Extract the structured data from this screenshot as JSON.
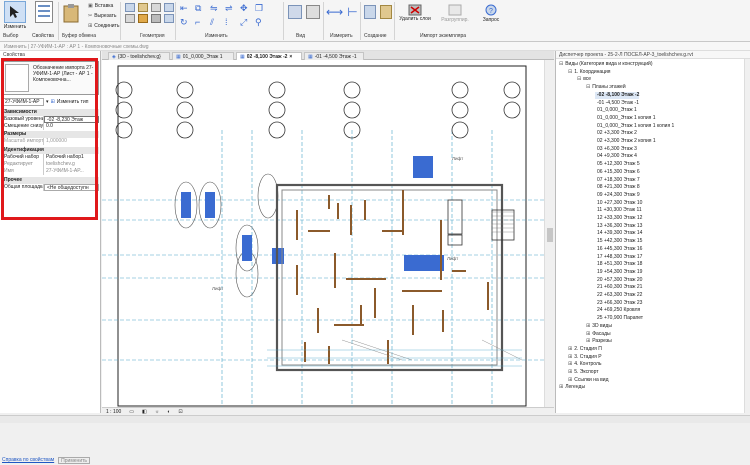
{
  "ribbon": {
    "modify_label": "Изменить",
    "select_label": "Выбор",
    "properties_label": "Свойства",
    "clipboard_label": "Буфер обмена",
    "cut_label": "Вырезать",
    "paste_label": "Вставка",
    "join_label": "Соединить",
    "geometry_label": "Геометрия",
    "modify_group_label": "Изменить",
    "view_label": "Вид",
    "measure_label": "Измерить",
    "create_label": "Создание",
    "delete_link_label": "Удалить слои",
    "unlock_label": "Разгруппир.",
    "query_label": "Запрос",
    "import_group_label": "Импорт экземпляра"
  },
  "status_hint": "Изменить | 27-УФИМ-1-АР : АР 1 - Компоновочные схемы.dwg",
  "properties": {
    "header": "Свойства",
    "type_text": "Обозначение импорта 27-УФИМ-1-АР (Лист - АР 1 - Компоновочна...",
    "type_selector": "27-УФИМ-1-АР",
    "edit_type": "Изменить тип",
    "sections": [
      {
        "title": "Зависимости",
        "rows": [
          [
            "Базовый уровень",
            "-02 -8,230 Этаж"
          ],
          [
            "Смещение снизу",
            "0.0"
          ]
        ]
      },
      {
        "title": "Размеры",
        "rows": [
          [
            "Масштаб импорта",
            "1,000000"
          ]
        ]
      },
      {
        "title": "Идентификация",
        "rows": [
          [
            "Рабочий набор",
            "Рабочий набор1"
          ],
          [
            "Редактирует",
            "toelishchev.g"
          ],
          [
            "Имя",
            "27-УФИМ-1-АР..."
          ]
        ]
      },
      {
        "title": "Прочее",
        "rows": [
          [
            "Общая площадка",
            "<Не общедоступн"
          ]
        ]
      }
    ],
    "help_link": "Справка по свойствам",
    "apply_button": "Применить"
  },
  "tabs": [
    {
      "label": "{3D - toelishchev.g}"
    },
    {
      "label": "01_0,000_Этаж 1"
    },
    {
      "label": "02 -8,100 Этаж -2"
    },
    {
      "label": "-01 -4,500 Этаж -1"
    }
  ],
  "canvas": {
    "tag_labels": [
      "Лифт",
      "Лифт",
      "Лифт"
    ],
    "scale": "1 : 100"
  },
  "browser": {
    "title": "Диспетчер проекта - 25-2-Л ПОСЕЛ-АР-3_toelishchev.g.rvt",
    "items": [
      {
        "level": 0,
        "text": "Виды (Категория вида и конструкций)",
        "prefix": "⊟"
      },
      {
        "level": 1,
        "text": "1. Координация",
        "prefix": "⊟"
      },
      {
        "level": 2,
        "text": "все",
        "prefix": "⊟"
      },
      {
        "level": 3,
        "text": "Планы этажей",
        "prefix": "⊟"
      },
      {
        "level": 4,
        "text": "-02 -8,100 Этаж -2",
        "prefix": "",
        "bold": true
      },
      {
        "level": 4,
        "text": "-01 -4,500 Этаж -1",
        "prefix": ""
      },
      {
        "level": 4,
        "text": "01_0,000_Этаж 1",
        "prefix": ""
      },
      {
        "level": 4,
        "text": "01_0,000_Этаж 1 копия 1",
        "prefix": ""
      },
      {
        "level": 4,
        "text": "01_0,000_Этаж 1 копия 1 копия 1",
        "prefix": ""
      },
      {
        "level": 4,
        "text": "02 +3,300 Этаж 2",
        "prefix": ""
      },
      {
        "level": 4,
        "text": "02 +3,300 Этаж 2 копия 1",
        "prefix": ""
      },
      {
        "level": 4,
        "text": "03 +6,300 Этаж 3",
        "prefix": ""
      },
      {
        "level": 4,
        "text": "04 +9,300 Этаж 4",
        "prefix": ""
      },
      {
        "level": 4,
        "text": "05 +12,300 Этаж 5",
        "prefix": ""
      },
      {
        "level": 4,
        "text": "06 +15,300 Этаж 6",
        "prefix": ""
      },
      {
        "level": 4,
        "text": "07 +18,300 Этаж 7",
        "prefix": ""
      },
      {
        "level": 4,
        "text": "08 +21,300 Этаж 8",
        "prefix": ""
      },
      {
        "level": 4,
        "text": "09 +24,300 Этаж 9",
        "prefix": ""
      },
      {
        "level": 4,
        "text": "10 +27,300 Этаж 10",
        "prefix": ""
      },
      {
        "level": 4,
        "text": "11 +30,300 Этаж 11",
        "prefix": ""
      },
      {
        "level": 4,
        "text": "12 +33,300 Этаж 12",
        "prefix": ""
      },
      {
        "level": 4,
        "text": "13 +36,300 Этаж 13",
        "prefix": ""
      },
      {
        "level": 4,
        "text": "14 +39,300 Этаж 14",
        "prefix": ""
      },
      {
        "level": 4,
        "text": "15 +42,300 Этаж 15",
        "prefix": ""
      },
      {
        "level": 4,
        "text": "16 +45,300 Этаж 16",
        "prefix": ""
      },
      {
        "level": 4,
        "text": "17 +48,300 Этаж 17",
        "prefix": ""
      },
      {
        "level": 4,
        "text": "18 +51,300 Этаж 18",
        "prefix": ""
      },
      {
        "level": 4,
        "text": "19 +54,300 Этаж 19",
        "prefix": ""
      },
      {
        "level": 4,
        "text": "20 +57,300 Этаж 20",
        "prefix": ""
      },
      {
        "level": 4,
        "text": "21 +60,300 Этаж 21",
        "prefix": ""
      },
      {
        "level": 4,
        "text": "22 +63,300 Этаж 22",
        "prefix": ""
      },
      {
        "level": 4,
        "text": "23 +66,300 Этаж 23",
        "prefix": ""
      },
      {
        "level": 4,
        "text": "24 +69,250 Кровля",
        "prefix": ""
      },
      {
        "level": 4,
        "text": "25 +70,900 Парапет",
        "prefix": ""
      },
      {
        "level": 3,
        "text": "3D виды",
        "prefix": "⊞"
      },
      {
        "level": 3,
        "text": "Фасады",
        "prefix": "⊞"
      },
      {
        "level": 3,
        "text": "Разрезы",
        "prefix": "⊞"
      },
      {
        "level": 1,
        "text": "2. Стадия П",
        "prefix": "⊞"
      },
      {
        "level": 1,
        "text": "3. Стадия Р",
        "prefix": "⊞"
      },
      {
        "level": 1,
        "text": "4. Контроль",
        "prefix": "⊞"
      },
      {
        "level": 1,
        "text": "5. Экспорт",
        "prefix": "⊞"
      },
      {
        "level": 1,
        "text": "Ссылки на вид",
        "prefix": "⊞"
      },
      {
        "level": 0,
        "text": "Легенды",
        "prefix": "⊞"
      }
    ]
  },
  "colors": {
    "accent_blue": "#3a6bd1",
    "highlight_red": "#e0181b",
    "wall_brown": "#8b5a2b",
    "grid_cyan": "#4aa3c8"
  }
}
